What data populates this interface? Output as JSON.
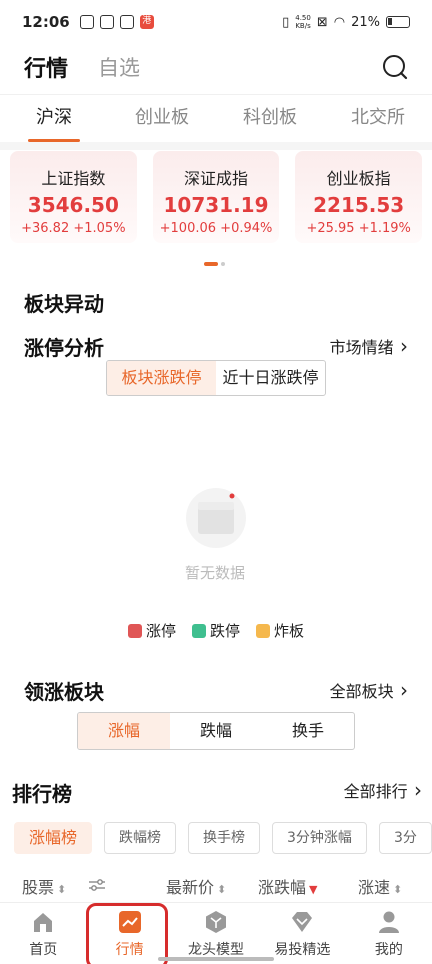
{
  "status": {
    "time": "12:06",
    "notif_badge": "港",
    "speed_top": "4.50",
    "speed_bottom": "KB/s",
    "battery": "21%"
  },
  "header": {
    "title": "行情",
    "tab2": "自选"
  },
  "market_tabs": [
    "沪深",
    "创业板",
    "科创板",
    "北交所"
  ],
  "indices": [
    {
      "name": "上证指数",
      "value": "3546.50",
      "change": "+36.82",
      "pct": "+1.05%"
    },
    {
      "name": "深证成指",
      "value": "10731.19",
      "change": "+100.06",
      "pct": "+0.94%"
    },
    {
      "name": "创业板指",
      "value": "2215.53",
      "change": "+25.95",
      "pct": "+1.19%"
    }
  ],
  "sector_move": {
    "title": "板块异动"
  },
  "limit_analysis": {
    "title": "涨停分析",
    "link": "市场情绪",
    "segments": [
      "板块涨跌停",
      "近十日涨跌停"
    ],
    "empty_text": "暂无数据",
    "legend": [
      {
        "label": "涨停",
        "color": "#e05656"
      },
      {
        "label": "跌停",
        "color": "#3fbf8f"
      },
      {
        "label": "炸板",
        "color": "#f5b84d"
      }
    ]
  },
  "leading_sectors": {
    "title": "领涨板块",
    "link": "全部板块",
    "segments": [
      "涨幅",
      "跌幅",
      "换手"
    ]
  },
  "ranking": {
    "title": "排行榜",
    "link": "全部排行",
    "tabs": [
      "涨幅榜",
      "跌幅榜",
      "换手榜",
      "3分钟涨幅",
      "3分"
    ],
    "columns": [
      "股票",
      "最新价",
      "涨跌幅",
      "涨速"
    ]
  },
  "tabbar": [
    "首页",
    "行情",
    "龙头模型",
    "易投精选",
    "我的"
  ],
  "colors": {
    "accent": "#e8672a",
    "up": "#e23d3d"
  }
}
